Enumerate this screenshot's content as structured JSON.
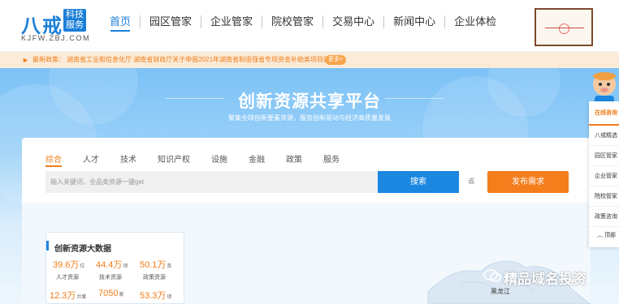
{
  "logo": {
    "brand": "八戒",
    "badge_line1": "科技",
    "badge_line2": "服务",
    "url": "KJFW.ZBJ.COM"
  },
  "nav": {
    "items": [
      {
        "label": "首页"
      },
      {
        "label": "园区管家"
      },
      {
        "label": "企业管家"
      },
      {
        "label": "院校管家"
      },
      {
        "label": "交易中心"
      },
      {
        "label": "新闻中心"
      },
      {
        "label": "企业体检"
      }
    ]
  },
  "notice": {
    "label": "最新政策：",
    "text": "湖南省工业和信息化厅 湖南省财政厅关于申报2021年湖南省制造强省专项资金补助类项目的通知",
    "more": "更多>"
  },
  "banner": {
    "title": "创新资源共享平台",
    "subtitle": "聚集全球创新要素资源，服务创新驱动与经济高质量发展"
  },
  "search": {
    "tabs": [
      {
        "label": "综合"
      },
      {
        "label": "人才"
      },
      {
        "label": "技术"
      },
      {
        "label": "知识产权"
      },
      {
        "label": "设施"
      },
      {
        "label": "金融"
      },
      {
        "label": "政策"
      },
      {
        "label": "服务"
      }
    ],
    "placeholder": "输入关键词，全品类资源一键get",
    "button": "搜索",
    "or": "或",
    "publish": "发布需求"
  },
  "stats": {
    "title": "创新资源大数据",
    "items": [
      {
        "value": "39.6万",
        "unit": "位",
        "label": "人才资源"
      },
      {
        "value": "44.4万",
        "unit": "项",
        "label": "技术资源"
      },
      {
        "value": "50.1万",
        "unit": "条",
        "label": "政策资源"
      },
      {
        "value": "12.3万",
        "unit": "台套",
        "label": ""
      },
      {
        "value": "7050",
        "unit": "家",
        "label": ""
      },
      {
        "value": "53.3万",
        "unit": "项",
        "label": ""
      }
    ]
  },
  "map": {
    "label": "黑龙江"
  },
  "float_panel": {
    "head": "在线咨询",
    "items": [
      {
        "label": "八戒精选"
      },
      {
        "label": "园区管家"
      },
      {
        "label": "企业管家"
      },
      {
        "label": "院校管家"
      },
      {
        "label": "政策咨询"
      }
    ],
    "top": "︿ 顶部"
  },
  "watermark": "精品域名投资",
  "colors": {
    "primary": "#1b87e0",
    "accent": "#f07c18"
  }
}
